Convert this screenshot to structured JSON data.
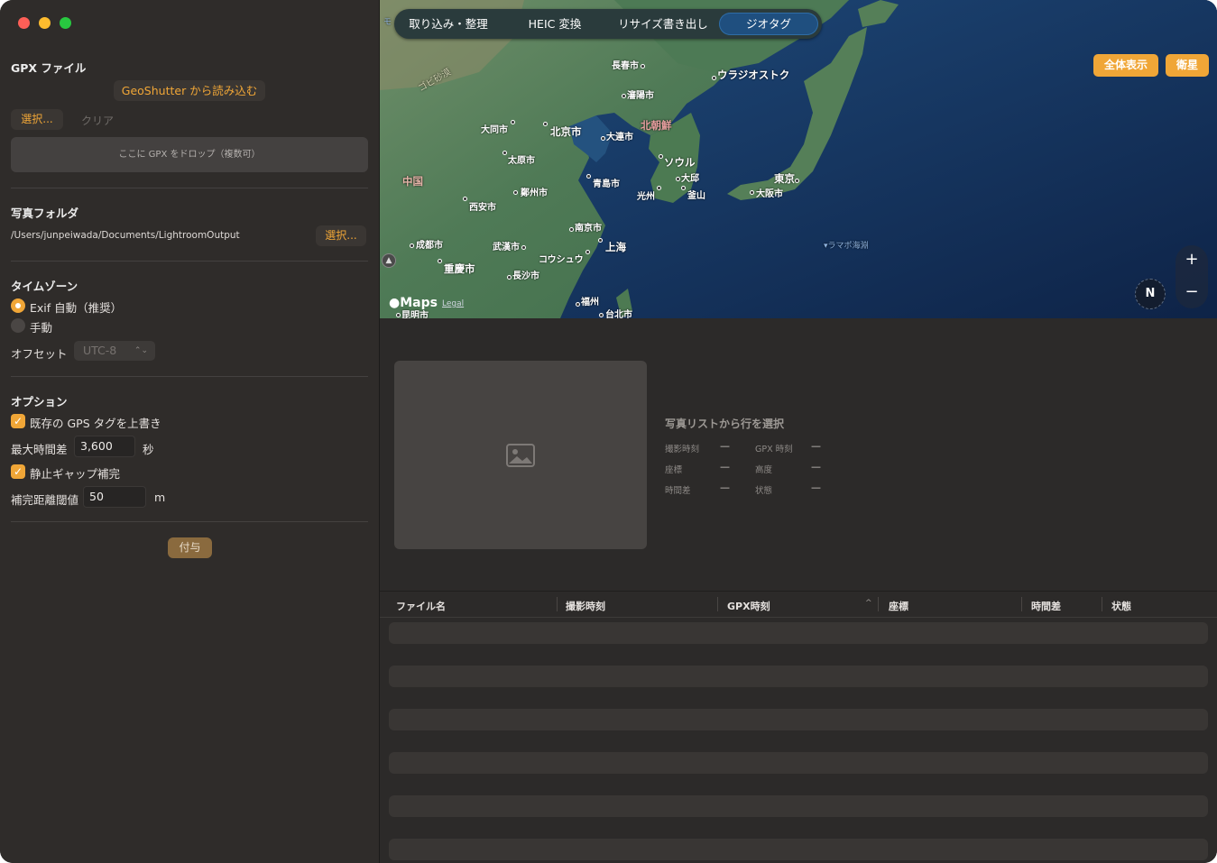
{
  "window": {
    "traffic_lights": [
      "close",
      "minimize",
      "maximize"
    ]
  },
  "sidebar": {
    "gpx": {
      "title": "GPX ファイル",
      "load_geoshutter": "GeoShutter から読み込む",
      "select": "選択...",
      "clear": "クリア",
      "drop_hint": "ここに GPX をドロップ（複数可）"
    },
    "photo_folder": {
      "title": "写真フォルダ",
      "path": "/Users/junpeiwada/Documents/LightroomOutput",
      "select": "選択..."
    },
    "timezone": {
      "title": "タイムゾーン",
      "exif_auto": "Exif 自動（推奨）",
      "manual": "手動",
      "offset_label": "オフセット",
      "offset_value": "UTC-8",
      "selected": "exif_auto"
    },
    "options": {
      "title": "オプション",
      "overwrite_gps": "既存の GPS タグを上書き",
      "overwrite_checked": true,
      "max_diff_label": "最大時間差",
      "max_diff_value": "3,600",
      "max_diff_unit": "秒",
      "static_gap": "静止ギャップ補完",
      "static_gap_checked": true,
      "threshold_label": "補完距離閾値",
      "threshold_value": "50",
      "threshold_unit": "m",
      "check_mark": "✓"
    },
    "apply": "付与"
  },
  "tabs": [
    {
      "label": "取り込み・整理"
    },
    {
      "label": "HEIC 変換"
    },
    {
      "label": "リサイズ書き出し"
    },
    {
      "label": "ジオタグ",
      "active": true
    }
  ],
  "map": {
    "show_all": "全体表示",
    "satellite": "衛星",
    "zoom_in": "+",
    "zoom_out": "−",
    "compass": "N",
    "logo": "Maps",
    "legal": "Legal",
    "labels": {
      "changchun": "長春市",
      "vladivostok": "ウラジオストク",
      "shenyang": "瀋陽市",
      "datong": "大同市",
      "beijing": "北京市",
      "dalian": "大連市",
      "north_korea": "北朝鮮",
      "taiyuan": "太原市",
      "seoul": "ソウル",
      "daegu": "大邱",
      "china": "中国",
      "zhengzhou": "鄭州市",
      "qingdao": "青島市",
      "gwangju": "光州",
      "busan": "釜山",
      "tokyo": "東京",
      "osaka": "大阪市",
      "xian": "西安市",
      "nanjing": "南京市",
      "chengdu": "成都市",
      "wuhan": "武漢市",
      "shanghai": "上海",
      "chongqing": "重慶市",
      "suzhou": "コウシュウ",
      "changsha": "長沙市",
      "fuzhou": "福州",
      "taipei": "台北市",
      "kunming": "昆明市",
      "ramapo": "▾ラマポ海淵",
      "gobi": "ゴビ砂漠",
      "top_edge": "モ"
    }
  },
  "detail": {
    "title": "写真リストから行を選択",
    "fields": [
      {
        "label": "撮影時刻",
        "value": "—"
      },
      {
        "label": "GPX 時刻",
        "value": "—"
      },
      {
        "label": "座標",
        "value": "—"
      },
      {
        "label": "高度",
        "value": "—"
      },
      {
        "label": "時間差",
        "value": "—"
      },
      {
        "label": "状態",
        "value": "—"
      }
    ]
  },
  "table": {
    "columns": [
      "ファイル名",
      "撮影時刻",
      "GPX時刻",
      "座標",
      "時間差",
      "状態"
    ],
    "sort_indicator": "^"
  }
}
